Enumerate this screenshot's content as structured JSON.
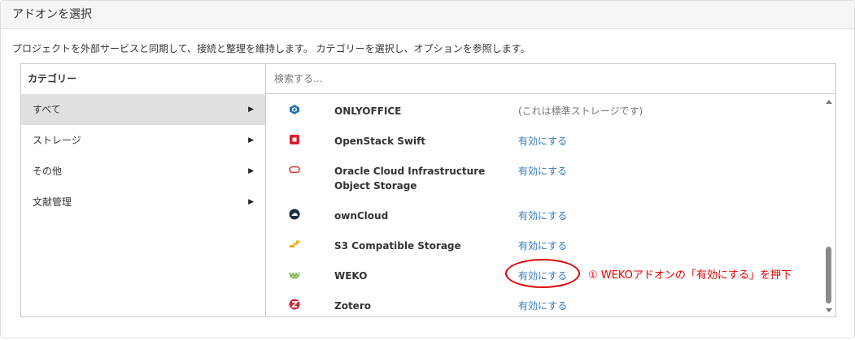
{
  "panel": {
    "title": "アドオンを選択",
    "description": "プロジェクトを外部サービスと同期して、接続と整理を維持します。 カテゴリーを選択し、オプションを参照します。"
  },
  "categories": {
    "header": "カテゴリー",
    "items": [
      {
        "label": "すべて",
        "arrow": "▶",
        "active": true
      },
      {
        "label": "ストレージ",
        "arrow": "▶"
      },
      {
        "label": "その他",
        "arrow": "▶"
      },
      {
        "label": "文献管理",
        "arrow": "▶"
      }
    ]
  },
  "search": {
    "placeholder": "検索する..."
  },
  "addons": [
    {
      "name": "ONLYOFFICE",
      "action": "(これは標準ストレージです)",
      "icon": "onlyoffice-icon"
    },
    {
      "name": "OpenStack Swift",
      "action": "有効にする",
      "icon": "openstack-icon"
    },
    {
      "name": "Oracle Cloud Infrastructure",
      "name2": "Object Storage",
      "action": "有効にする",
      "icon": "oracle-icon"
    },
    {
      "name": "ownCloud",
      "action": "有効にする",
      "icon": "owncloud-icon"
    },
    {
      "name": "S3 Compatible Storage",
      "action": "有効にする",
      "icon": "s3-icon"
    },
    {
      "name": "WEKO",
      "action": "有効にする",
      "icon": "weko-icon"
    },
    {
      "name": "Zotero",
      "action": "有効にする",
      "icon": "zotero-icon"
    }
  ],
  "annotation": {
    "text": "① WEKOアドオンの「有効にする」を押下"
  },
  "colors": {
    "link": "#337ab7",
    "annotation": "#e00000",
    "active_bg": "#e0e0e0"
  }
}
